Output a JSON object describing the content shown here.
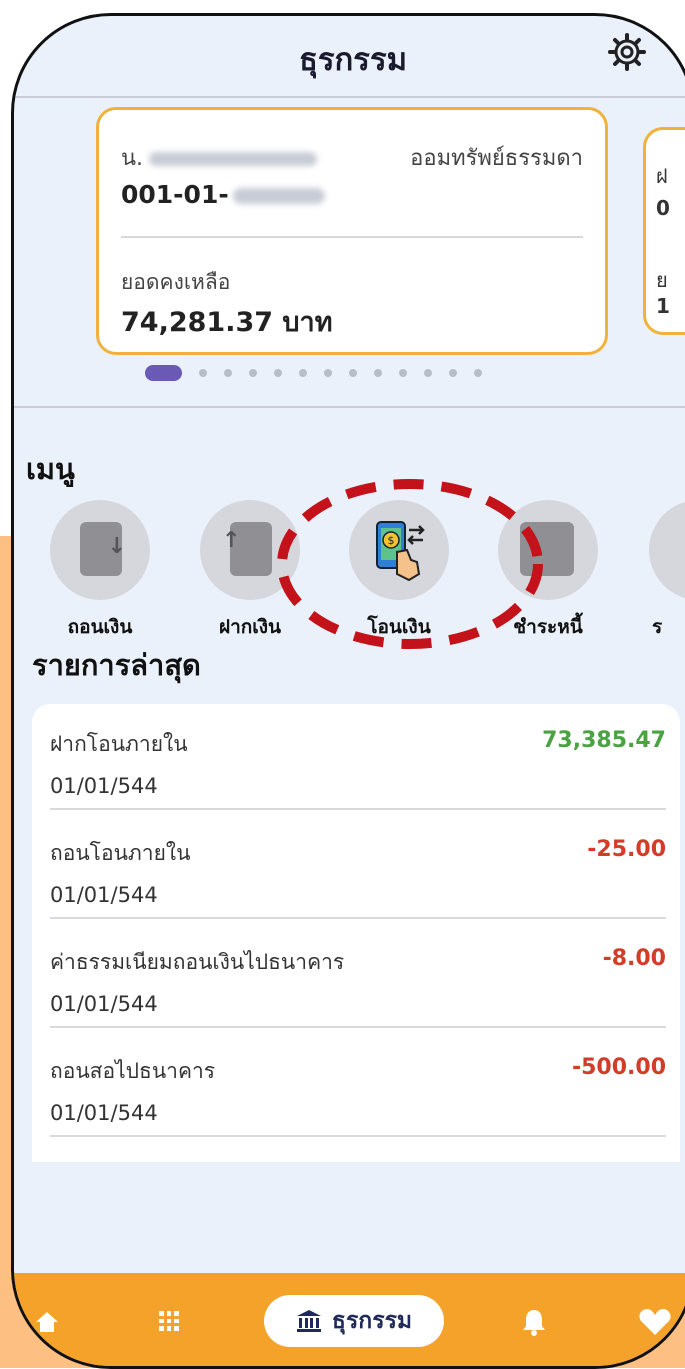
{
  "header": {
    "title": "ธุรกรรม",
    "settings_icon": "gear-icon"
  },
  "account": {
    "owner_prefix": "น.",
    "type": "ออมทรัพย์ธรรมดา",
    "number": "001-01-",
    "balance_label": "ยอดคงเหลือ",
    "balance": "74,281.37 บาท",
    "border_color": "#f0b23a"
  },
  "account_next": {
    "line1": "ฝ",
    "line2": "0",
    "line3": "ย",
    "line4": "1"
  },
  "carousel": {
    "active_index": 0,
    "count": 13,
    "active_color": "#6a59b5"
  },
  "menu": {
    "title": "เมนู",
    "items": [
      {
        "label": "ถอนเงิน",
        "icon": "withdraw-icon"
      },
      {
        "label": "ฝากเงิน",
        "icon": "deposit-icon"
      },
      {
        "label": "โอนเงิน",
        "icon": "transfer-icon"
      },
      {
        "label": "ชำระหนี้",
        "icon": "pay-debt-icon"
      },
      {
        "label": "ร",
        "icon": "more-icon"
      }
    ],
    "highlight_color": "#c4121a"
  },
  "recent": {
    "title": "รายการล่าสุด",
    "transactions": [
      {
        "desc": "ฝากโอนภายใน",
        "date": "01/01/544",
        "amount": "73,385.47",
        "kind": "positive"
      },
      {
        "desc": "ถอนโอนภายใน",
        "date": "01/01/544",
        "amount": "-25.00",
        "kind": "negative"
      },
      {
        "desc": "ค่าธรรมเนียมถอนเงินไปธนาคาร",
        "date": "01/01/544",
        "amount": "-8.00",
        "kind": "negative"
      },
      {
        "desc": "ถอนสอไปธนาคาร",
        "date": "01/01/544",
        "amount": "-500.00",
        "kind": "negative"
      }
    ],
    "positive_color": "#49a340",
    "negative_color": "#d23c28"
  },
  "bottom_nav": {
    "items": [
      {
        "label": "",
        "icon": "home-icon"
      },
      {
        "label": "",
        "icon": "grid-icon"
      },
      {
        "label": "ธุรกรรม",
        "icon": "bank-icon",
        "active": true
      },
      {
        "label": "",
        "icon": "bell-icon"
      },
      {
        "label": "",
        "icon": "heart-icon"
      }
    ],
    "bg_color": "#f4a229"
  }
}
